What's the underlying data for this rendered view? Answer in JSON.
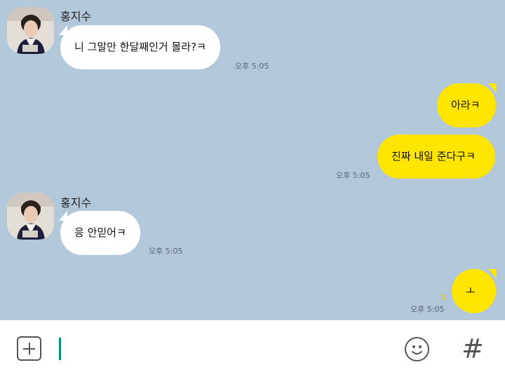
{
  "messages": [
    {
      "direction": "in",
      "sender": "홍지수",
      "text": "니 그말만 한달째인거 몰라?ㅋ",
      "time": "오후 5:05"
    },
    {
      "direction": "out",
      "text": "아라ㅋ"
    },
    {
      "direction": "out",
      "text": "진짜 내일 준다구ㅋ",
      "time": "오후 5:05"
    },
    {
      "direction": "in",
      "sender": "홍지수",
      "text": "응 안믿어ㅋ",
      "time": "오후 5:05"
    },
    {
      "direction": "out",
      "text": "ㅗ",
      "time": "오후 5:05",
      "read_count": "1"
    }
  ],
  "input": {
    "value": "",
    "buttons": [
      "plus-icon",
      "emoji-icon",
      "hashtag-icon"
    ]
  },
  "icons": {
    "hashtag_glyph": "#"
  },
  "colors": {
    "chat_background": "#b2c7d9",
    "incoming_bubble": "#ffffff",
    "outgoing_bubble": "#fee500",
    "cursor": "#0a8a7a"
  }
}
